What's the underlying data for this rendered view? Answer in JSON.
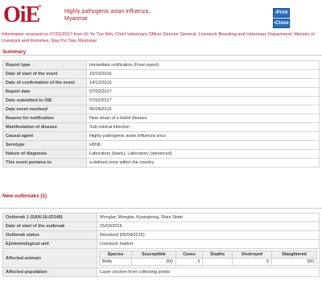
{
  "header": {
    "logo_text": "OiE",
    "title_line1": "Highly pathogenic avian influenza,",
    "title_line2": "Myanmar",
    "print_label": "Print",
    "close_label": "Close"
  },
  "info_text": "Information received on 07/02/2017 from Dr Ye Tun Win, Chief Veterinary Officer Director General, Livestock Breeding and Veterinary Department, Ministry of Livestock and Fisheries, Nay Pyi Taw, Myanmar",
  "summary": {
    "heading": "Summary",
    "rows": [
      {
        "k": "Report type",
        "v": "Immediate notification (Final report)"
      },
      {
        "k": "Date of start of the event",
        "v": "15/03/2016"
      },
      {
        "k": "Date of confirmation of the event",
        "v": "14/12/2016"
      },
      {
        "k": "Report date",
        "v": "07/02/2017"
      },
      {
        "k": "Date submitted to OIE",
        "v": "07/02/2017"
      },
      {
        "k": "Date event resolved",
        "v": "06/04/2016"
      },
      {
        "k": "Reason for notification",
        "v": "New strain of a listed disease"
      },
      {
        "k": "Manifestation of disease",
        "v": "Sub-clinical infection"
      },
      {
        "k": "Causal agent",
        "v": "Highly pathogenic avian influenza virus"
      },
      {
        "k": "Serotype",
        "v": "H5N6"
      },
      {
        "k": "Nature of diagnosis",
        "v": "Laboratory (basic), Laboratory (advanced)"
      },
      {
        "k": "This event pertains to",
        "v": "a defined zone within the country"
      }
    ]
  },
  "outbreaks": {
    "heading": "New outbreaks (1)",
    "rows": [
      {
        "k": "Outbreak 1 (SAN:16-03146)",
        "v": "Monglar, Monglar, Kyaingtong, Shan State"
      },
      {
        "k": "Date of start of the outbreak",
        "v": "15/03/2016"
      },
      {
        "k": "Outbreak status",
        "v": "Resolved (06/04/2016)"
      },
      {
        "k": "Epidemiological unit",
        "v": "Livestock market"
      }
    ],
    "animals_label": "Affected animals",
    "animals_headers": [
      "Species",
      "Susceptible",
      "Cases",
      "Deaths",
      "Destroyed",
      "Slaughtered"
    ],
    "animals_row": [
      "Birds",
      "300",
      "5",
      "",
      "0",
      "300"
    ],
    "population_label": "Affected population",
    "population_value": "Layer chicken from collecting points"
  }
}
